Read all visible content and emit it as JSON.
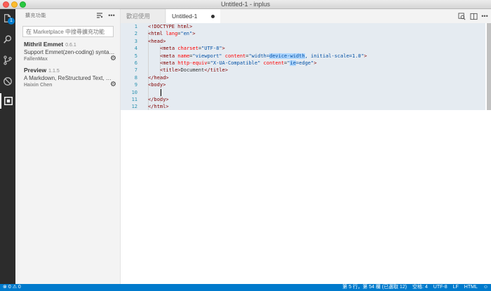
{
  "window": {
    "title": "Untitled-1 - inplus"
  },
  "activity_bar": {
    "items": [
      {
        "name": "explorer",
        "icon": "files-icon",
        "badge": "1"
      },
      {
        "name": "search",
        "icon": "search-icon"
      },
      {
        "name": "git",
        "icon": "git-branch-icon"
      },
      {
        "name": "debug",
        "icon": "debug-icon"
      },
      {
        "name": "extensions",
        "icon": "extensions-icon"
      }
    ]
  },
  "sidebar": {
    "title": "擴充功能",
    "search_placeholder": "在 Marketplace 中搜尋擴充功能",
    "extensions": [
      {
        "name": "Mithril Emmet",
        "version": "0.6.1",
        "description": "Support Emmet(zen-coding) syntax f...",
        "author": "FallenMax"
      },
      {
        "name": "Preview",
        "version": "1.1.5",
        "description": "A Markdown, ReStructured Text, HT...",
        "author": "Haixin Chen"
      }
    ]
  },
  "tabs": [
    {
      "label": "歡迎使用",
      "active": false
    },
    {
      "label": "Untitled-1",
      "active": true,
      "dirty": true
    }
  ],
  "editor": {
    "line_numbers": [
      "1",
      "2",
      "3",
      "4",
      "5",
      "6",
      "7",
      "8",
      "9",
      "10",
      "11",
      "12"
    ],
    "lines": {
      "l1": "<!DOCTYPE html>",
      "l2_open": "<html ",
      "l2_attr": "lang",
      "l2_eq": "=",
      "l2_str": "\"en\"",
      "l2_close": ">",
      "l3": "<head>",
      "l4_open": "<meta ",
      "l4_attr": "charset",
      "l4_eq": "=",
      "l4_str": "\"UTF-8\"",
      "l4_close": ">",
      "l5_open": "<meta ",
      "l5_attr1": "name",
      "l5_str1": "\"viewport\"",
      "l5_attr2": " content",
      "l5_str2a": "\"width=",
      "l5_hl": "device-width",
      "l5_str2b": ", initial-scale=1.0\"",
      "l5_close": ">",
      "l6_open": "<meta ",
      "l6_attr1": "http-equiv",
      "l6_str1": "\"X-UA-Compatible\"",
      "l6_attr2": " content",
      "l6_str2a": "\"",
      "l6_hl": "ie",
      "l6_str2b": "=edge\"",
      "l6_close": ">",
      "l7_open": "<title>",
      "l7_text": "Document",
      "l7_close": "</title>",
      "l8": "</head>",
      "l9": "<body>",
      "l10": "",
      "l11": "</body>",
      "l12": "</html>"
    }
  },
  "statusbar": {
    "errors": "0",
    "warnings": "0",
    "position": "第 5 行，第 54 欄 (已選取 12)",
    "indent": "空格: 4",
    "encoding": "UTF-8",
    "eol": "LF",
    "language": "HTML"
  }
}
